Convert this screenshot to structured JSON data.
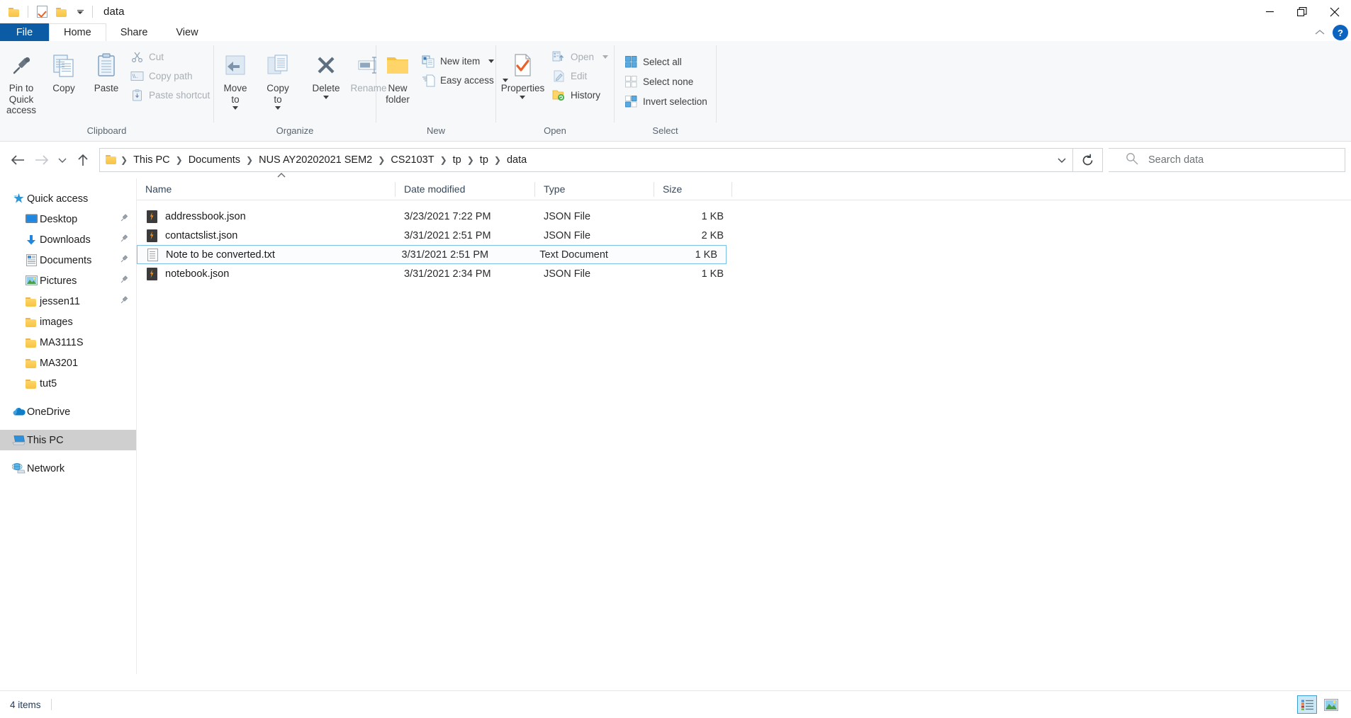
{
  "window": {
    "title": "data",
    "controls": {
      "minimize": "minimize-icon",
      "restore": "restore-icon",
      "close": "close-icon"
    }
  },
  "quick_access_toolbar": {
    "items": [
      {
        "name": "folder-icon",
        "label": ""
      },
      {
        "name": "properties-check-icon",
        "label": ""
      },
      {
        "name": "new-folder-icon",
        "label": ""
      },
      {
        "name": "customize-dropdown-icon",
        "label": ""
      }
    ]
  },
  "ribbon": {
    "tabs": [
      {
        "label": "File",
        "id": "file",
        "active": false
      },
      {
        "label": "Home",
        "id": "home",
        "active": true
      },
      {
        "label": "Share",
        "id": "share",
        "active": false
      },
      {
        "label": "View",
        "id": "view",
        "active": false
      }
    ],
    "help_label": "?",
    "groups": [
      {
        "label": "Clipboard",
        "big_buttons": [
          {
            "label": "Pin to Quick\naccess",
            "icon": "pin-icon",
            "disabled": false
          },
          {
            "label": "Copy",
            "icon": "copy-icon",
            "disabled": false
          },
          {
            "label": "Paste",
            "icon": "paste-icon",
            "disabled": false
          }
        ],
        "small_buttons": [
          {
            "label": "Cut",
            "icon": "scissors-icon",
            "disabled": true
          },
          {
            "label": "Copy path",
            "icon": "copy-path-icon",
            "disabled": true
          },
          {
            "label": "Paste shortcut",
            "icon": "paste-shortcut-icon",
            "disabled": true
          }
        ]
      },
      {
        "label": "Organize",
        "big_buttons": [
          {
            "label": "Move\nto",
            "icon": "move-to-icon",
            "dropdown": true
          },
          {
            "label": "Copy\nto",
            "icon": "copy-to-icon",
            "dropdown": true
          },
          {
            "label": "Delete",
            "icon": "delete-x-icon",
            "dropdown": true
          },
          {
            "label": "Rename",
            "icon": "rename-icon",
            "disabled": true
          }
        ]
      },
      {
        "label": "New",
        "big_buttons": [
          {
            "label": "New\nfolder",
            "icon": "new-folder-icon"
          }
        ],
        "small_buttons": [
          {
            "label": "New item",
            "icon": "new-item-icon",
            "dropdown": true
          },
          {
            "label": "Easy access",
            "icon": "easy-access-icon",
            "dropdown": true
          }
        ]
      },
      {
        "label": "Open",
        "big_buttons": [
          {
            "label": "Properties",
            "icon": "properties-icon",
            "dropdown": true
          }
        ],
        "small_buttons": [
          {
            "label": "Open",
            "icon": "open-icon",
            "dropdown": true,
            "disabled": true
          },
          {
            "label": "Edit",
            "icon": "edit-icon",
            "disabled": true
          },
          {
            "label": "History",
            "icon": "history-icon",
            "disabled": false
          }
        ]
      },
      {
        "label": "Select",
        "small_buttons": [
          {
            "label": "Select all",
            "icon": "select-all-icon"
          },
          {
            "label": "Select none",
            "icon": "select-none-icon"
          },
          {
            "label": "Invert selection",
            "icon": "invert-selection-icon"
          }
        ]
      }
    ]
  },
  "address_bar": {
    "back": "back-arrow-icon",
    "forward": "forward-arrow-icon",
    "recent": "recent-locations-icon",
    "up": "up-arrow-icon",
    "breadcrumb": [
      "This PC",
      "Documents",
      "NUS AY20202021 SEM2",
      "CS2103T",
      "tp",
      "tp",
      "data"
    ],
    "dropdown": "address-dropdown-icon",
    "refresh": "refresh-icon",
    "search_placeholder": "Search data"
  },
  "nav_pane": {
    "items": [
      {
        "label": "Quick access",
        "icon": "quick-access-star-icon",
        "level": 0,
        "pinned": false,
        "selected": false
      },
      {
        "label": "Desktop",
        "icon": "desktop-icon",
        "level": 1,
        "pinned": true,
        "selected": false
      },
      {
        "label": "Downloads",
        "icon": "downloads-icon",
        "level": 1,
        "pinned": true,
        "selected": false
      },
      {
        "label": "Documents",
        "icon": "documents-icon",
        "level": 1,
        "pinned": true,
        "selected": false
      },
      {
        "label": "Pictures",
        "icon": "pictures-icon",
        "level": 1,
        "pinned": true,
        "selected": false
      },
      {
        "label": "jessen11",
        "icon": "folder-icon",
        "level": 1,
        "pinned": true,
        "selected": false
      },
      {
        "label": "images",
        "icon": "folder-icon",
        "level": 1,
        "pinned": false,
        "selected": false
      },
      {
        "label": "MA3111S",
        "icon": "folder-icon",
        "level": 1,
        "pinned": false,
        "selected": false
      },
      {
        "label": "MA3201",
        "icon": "folder-icon",
        "level": 1,
        "pinned": false,
        "selected": false
      },
      {
        "label": "tut5",
        "icon": "folder-icon",
        "level": 1,
        "pinned": false,
        "selected": false
      },
      {
        "label": "OneDrive",
        "icon": "onedrive-cloud-icon",
        "level": 0,
        "pinned": false,
        "selected": false,
        "gap_before": true
      },
      {
        "label": "This PC",
        "icon": "this-pc-icon",
        "level": 0,
        "pinned": false,
        "selected": true,
        "gap_before": true
      },
      {
        "label": "Network",
        "icon": "network-icon",
        "level": 0,
        "pinned": false,
        "selected": false,
        "gap_before": true
      }
    ]
  },
  "file_list": {
    "columns": [
      {
        "key": "name",
        "label": "Name",
        "sorted": "asc"
      },
      {
        "key": "date",
        "label": "Date modified",
        "sorted": null
      },
      {
        "key": "type",
        "label": "Type",
        "sorted": null
      },
      {
        "key": "size",
        "label": "Size",
        "sorted": null
      }
    ],
    "rows": [
      {
        "name": "addressbook.json",
        "date": "3/23/2021 7:22 PM",
        "type": "JSON File",
        "size": "1 KB",
        "icon": "json-file-icon",
        "selected": false
      },
      {
        "name": "contactslist.json",
        "date": "3/31/2021 2:51 PM",
        "type": "JSON File",
        "size": "2 KB",
        "icon": "json-file-icon",
        "selected": false
      },
      {
        "name": "Note to be converted.txt",
        "date": "3/31/2021 2:51 PM",
        "type": "Text Document",
        "size": "1 KB",
        "icon": "text-file-icon",
        "selected": true
      },
      {
        "name": "notebook.json",
        "date": "3/31/2021 2:34 PM",
        "type": "JSON File",
        "size": "1 KB",
        "icon": "json-file-icon",
        "selected": false
      }
    ]
  },
  "status_bar": {
    "item_count": "4 items",
    "views": [
      {
        "name": "details-view-button",
        "active": true
      },
      {
        "name": "large-icons-view-button",
        "active": false
      }
    ]
  }
}
